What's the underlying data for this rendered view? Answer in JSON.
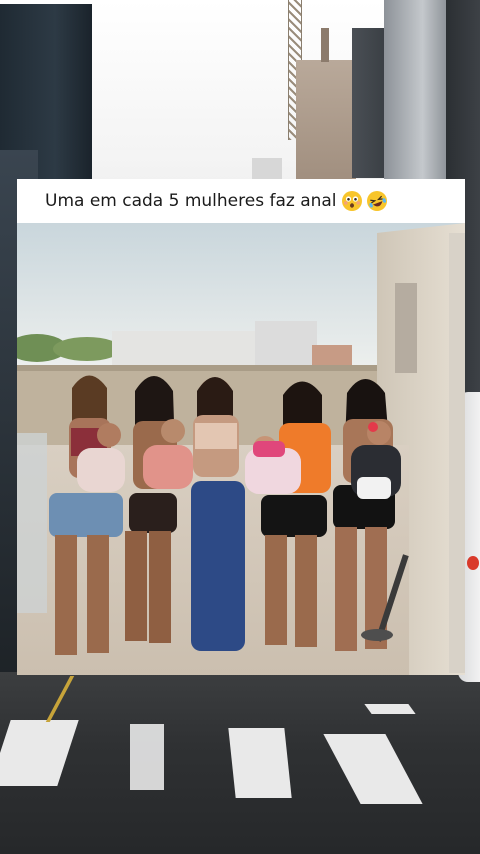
{
  "caption": {
    "text": "Uma em cada 5 mulheres faz anal",
    "emojis": [
      "flushed-face-emoji",
      "laughing-face-emoji"
    ]
  },
  "colors": {
    "caption_bg": "#ffffff",
    "caption_text": "#1b1b1b",
    "road": "#2f3133",
    "crosswalk": "#e9e9e9",
    "emoji_yellow": "#f8c52b"
  }
}
